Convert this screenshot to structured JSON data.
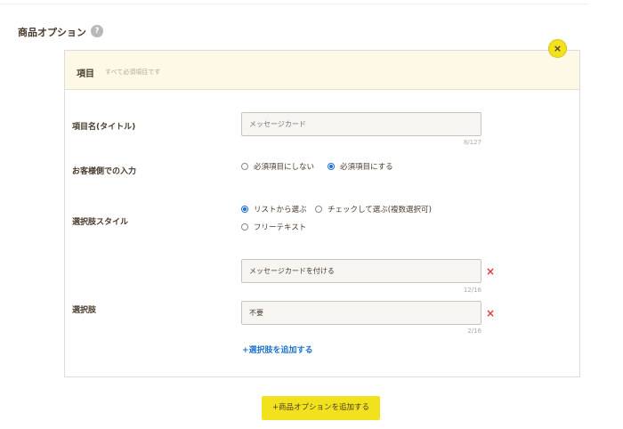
{
  "section": {
    "title": "商品オプション",
    "help_icon": "?"
  },
  "card": {
    "header_title": "項目",
    "header_note": "すべて必須項目です",
    "close_icon": "×"
  },
  "item_name": {
    "label": "項目名(タイトル)",
    "placeholder": "メッセージカード",
    "counter": "8/127"
  },
  "customer_input": {
    "label": "お客様側での入力",
    "options": [
      {
        "label": "必須項目にしない",
        "selected": false
      },
      {
        "label": "必須項目にする",
        "selected": true
      }
    ]
  },
  "choice_style": {
    "label": "選択肢スタイル",
    "options": [
      {
        "label": "リストから選ぶ",
        "selected": true
      },
      {
        "label": "チェックして選ぶ(複数選択可)",
        "selected": false
      },
      {
        "label": "フリーテキスト",
        "selected": false
      }
    ]
  },
  "choices": {
    "label": "選択肢",
    "items": [
      {
        "value": "メッセージカードを付ける",
        "counter": "12/16"
      },
      {
        "value": "不要",
        "counter": "2/16"
      }
    ],
    "delete_icon": "×",
    "add_label": "+選択肢を追加する"
  },
  "add_option_button": "+商品オプションを追加する",
  "colors": {
    "accent_yellow": "#f2e21d",
    "header_bg": "#fdf9e6",
    "link_blue": "#1f75cf",
    "delete_red": "#e23b3b",
    "text_brown": "#4a3b2c"
  }
}
